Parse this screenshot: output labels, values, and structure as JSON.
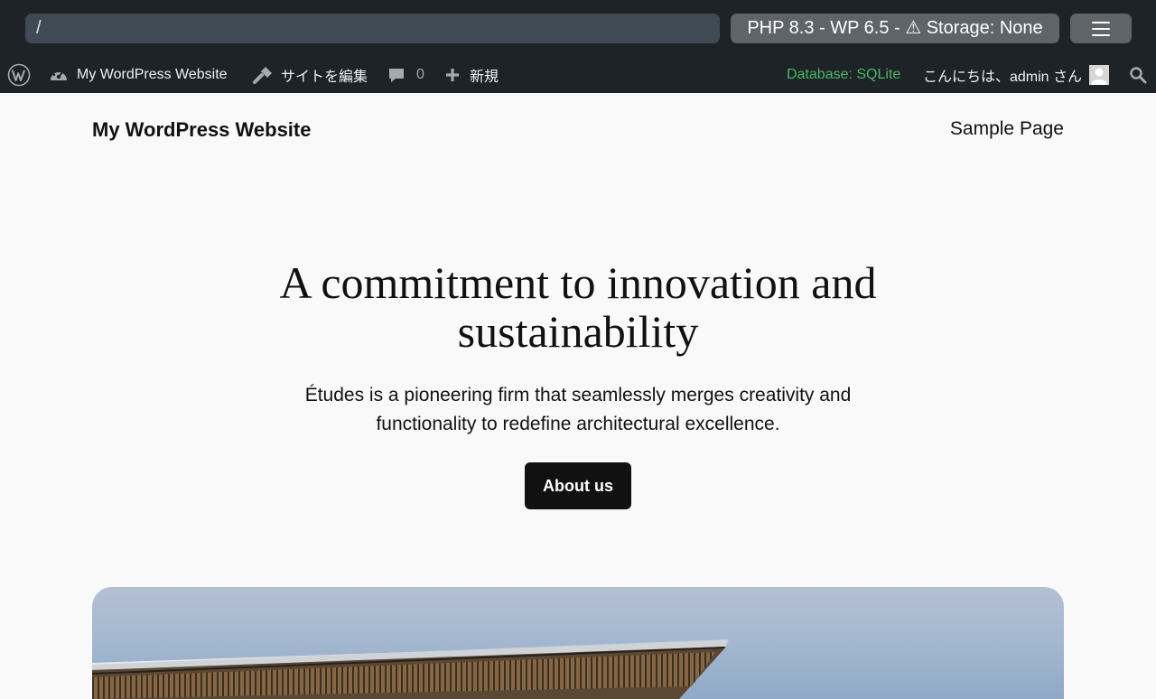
{
  "playground": {
    "url": "/",
    "info": "PHP 8.3 - WP 6.5 - ⚠ Storage: None",
    "menu_icon": "hamburger-icon"
  },
  "adminbar": {
    "wp_logo_icon": "wordpress-logo-icon",
    "site_icon": "dashboard-icon",
    "site_name": "My WordPress Website",
    "edit_icon": "brush-icon",
    "edit_label": "サイトを編集",
    "comments_icon": "comment-icon",
    "comments_count": "0",
    "new_icon": "plus-icon",
    "new_label": "新規",
    "database_status": "Database: SQLite",
    "greeting": "こんにちは、admin さん",
    "search_icon": "search-icon"
  },
  "site": {
    "title": "My WordPress Website",
    "nav": [
      "Sample Page"
    ]
  },
  "hero": {
    "heading_line1": "A commitment to innovation and",
    "heading_line2": "sustainability",
    "desc_line1": "Études is a pioneering firm that seamlessly merges creativity and",
    "desc_line2": "functionality to redefine architectural excellence.",
    "button": "About us"
  },
  "colors": {
    "toolbar_bg": "#1e2327",
    "url_bg": "#3f4a55",
    "button_bg": "#5f6469",
    "database_green": "#4ab866",
    "page_bg": "#f9f9f9",
    "cta_bg": "#111111"
  }
}
